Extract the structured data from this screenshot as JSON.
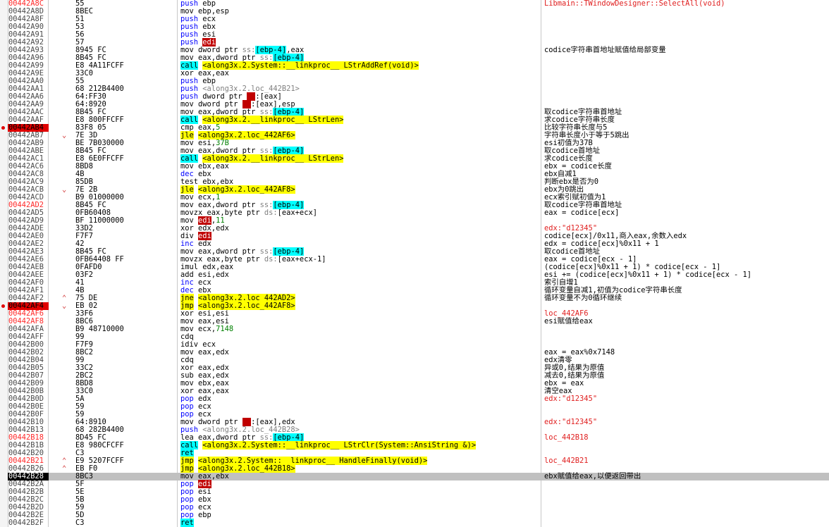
{
  "rows": [
    {
      "addr": "00442A8C",
      "bytes": "55",
      "mn": "push",
      "ops": [
        {
          "t": "ebp"
        }
      ],
      "cmt": "Libmain::TWindowDesigner::SelectAll(void)",
      "cmtRed": true,
      "addrHl": true
    },
    {
      "addr": "00442A8D",
      "bytes": "8BEC",
      "mn": "mov",
      "ops": [
        {
          "t": "ebp,esp"
        }
      ]
    },
    {
      "addr": "00442A8F",
      "bytes": "51",
      "mn": "push",
      "ops": [
        {
          "t": "ecx"
        }
      ]
    },
    {
      "addr": "00442A90",
      "bytes": "53",
      "mn": "push",
      "ops": [
        {
          "t": "ebx"
        }
      ]
    },
    {
      "addr": "00442A91",
      "bytes": "56",
      "mn": "push",
      "ops": [
        {
          "t": "esi"
        }
      ]
    },
    {
      "addr": "00442A92",
      "bytes": "57",
      "mn": "push",
      "ops": [
        {
          "t": "edi",
          "c": "edi"
        }
      ]
    },
    {
      "addr": "00442A93",
      "bytes": "8945 FC",
      "mn": "mov",
      "ops": [
        {
          "t": "dword ptr "
        },
        {
          "t": "ss:",
          "c": "seg"
        },
        {
          "t": "[ebp-4]",
          "c": "mem"
        },
        {
          "t": ",eax"
        }
      ],
      "cmt": "codice字符串首地址赋值给局部变量"
    },
    {
      "addr": "00442A96",
      "bytes": "8B45 FC",
      "mn": "mov",
      "ops": [
        {
          "t": "eax,dword ptr "
        },
        {
          "t": "ss:",
          "c": "seg"
        },
        {
          "t": "[ebp-4]",
          "c": "mem"
        }
      ]
    },
    {
      "addr": "00442A99",
      "bytes": "E8 4A11FCFF",
      "mn": "call",
      "ops": [
        {
          "t": "<along3x.2.System::__linkproc__ LStrAddRef(void)>",
          "c": "callsym"
        }
      ]
    },
    {
      "addr": "00442A9E",
      "bytes": "33C0",
      "mn": "xor",
      "ops": [
        {
          "t": "eax,eax"
        }
      ]
    },
    {
      "addr": "00442AA0",
      "bytes": "55",
      "mn": "push",
      "ops": [
        {
          "t": "ebp"
        }
      ]
    },
    {
      "addr": "00442AA1",
      "bytes": "68 212B4400",
      "bytesU": "212B4400",
      "mn": "push",
      "ops": [
        {
          "t": "<along3x.2.loc_442B21>",
          "c": "sym"
        }
      ]
    },
    {
      "addr": "00442AA6",
      "bytes": "64:FF30",
      "mn": "push",
      "ops": [
        {
          "t": "dword ptr "
        },
        {
          "t": "fs",
          "c": "fs"
        },
        {
          "t": ":[eax]"
        }
      ]
    },
    {
      "addr": "00442AA9",
      "bytes": "64:8920",
      "mn": "mov",
      "ops": [
        {
          "t": "dword ptr "
        },
        {
          "t": "fs",
          "c": "fs"
        },
        {
          "t": ":[eax],esp"
        }
      ]
    },
    {
      "addr": "00442AAC",
      "bytes": "8B45 FC",
      "mn": "mov",
      "ops": [
        {
          "t": "eax,dword ptr "
        },
        {
          "t": "ss:",
          "c": "seg"
        },
        {
          "t": "[ebp-4]",
          "c": "mem"
        }
      ],
      "cmt": "取codice字符串首地址"
    },
    {
      "addr": "00442AAF",
      "bytes": "E8 800FFCFF",
      "mn": "call",
      "ops": [
        {
          "t": "<along3x.2.__linkproc__ LStrLen>",
          "c": "callsym"
        }
      ],
      "cmt": "求codice字符串长度"
    },
    {
      "addr": "00442AB4",
      "bytes": "83F8 05",
      "mn": "cmp",
      "ops": [
        {
          "t": "eax,"
        },
        {
          "t": "5",
          "c": "num"
        }
      ],
      "cmt": "比较字符串长度与5",
      "bp": true
    },
    {
      "addr": "00442AB7",
      "bytes": "7E 3D",
      "mn": "jle",
      "ops": [
        {
          "t": "<along3x.2.loc_442AF6>",
          "c": "jmpsym"
        }
      ],
      "cmt": "字符串长度小于等于5跳出",
      "arrow": "⌄"
    },
    {
      "addr": "00442AB9",
      "bytes": "BE 7B030000",
      "mn": "mov",
      "ops": [
        {
          "t": "esi,"
        },
        {
          "t": "37B",
          "c": "num"
        }
      ],
      "cmt": "esi初值为37B"
    },
    {
      "addr": "00442ABE",
      "bytes": "8B45 FC",
      "mn": "mov",
      "ops": [
        {
          "t": "eax,dword ptr "
        },
        {
          "t": "ss:",
          "c": "seg"
        },
        {
          "t": "[ebp-4]",
          "c": "mem"
        }
      ],
      "cmt": "取codice首地址"
    },
    {
      "addr": "00442AC1",
      "bytes": "E8 6E0FFCFF",
      "mn": "call",
      "ops": [
        {
          "t": "<along3x.2.__linkproc__ LStrLen>",
          "c": "callsym"
        }
      ],
      "cmt": "求codice长度"
    },
    {
      "addr": "00442AC6",
      "bytes": "8BD8",
      "mn": "mov",
      "ops": [
        {
          "t": "ebx,eax"
        }
      ],
      "cmt": "ebx = codice长度"
    },
    {
      "addr": "00442AC8",
      "bytes": "4B",
      "mn": "dec",
      "ops": [
        {
          "t": "ebx"
        }
      ],
      "cmt": "ebx自减1"
    },
    {
      "addr": "00442AC9",
      "bytes": "85DB",
      "mn": "test",
      "ops": [
        {
          "t": "ebx,ebx"
        }
      ],
      "cmt": "判断ebx是否为0"
    },
    {
      "addr": "00442ACB",
      "bytes": "7E 2B",
      "mn": "jle",
      "ops": [
        {
          "t": "<along3x.2.loc_442AF8>",
          "c": "jmpsym"
        }
      ],
      "cmt": "ebx为0跳出",
      "arrow": "⌄"
    },
    {
      "addr": "00442ACD",
      "bytes": "B9 01000000",
      "mn": "mov",
      "ops": [
        {
          "t": "ecx,"
        },
        {
          "t": "1",
          "c": "num"
        }
      ],
      "cmt": "ecx索引赋初值为1"
    },
    {
      "addr": "00442AD2",
      "bytes": "8B45 FC",
      "mn": "mov",
      "ops": [
        {
          "t": "eax,dword ptr "
        },
        {
          "t": "ss:",
          "c": "seg"
        },
        {
          "t": "[ebp-4]",
          "c": "mem"
        }
      ],
      "cmt": "取codice字符串首地址",
      "addrHl": true
    },
    {
      "addr": "00442AD5",
      "bytes": "0FB60408",
      "mn": "movzx",
      "ops": [
        {
          "t": "eax,byte ptr "
        },
        {
          "t": "ds:",
          "c": "seg"
        },
        {
          "t": "[eax+ecx]"
        }
      ],
      "cmt": "eax = codice[ecx]"
    },
    {
      "addr": "00442AD9",
      "bytes": "BF 11000000",
      "mn": "mov",
      "ops": [
        {
          "t": "edi",
          "c": "edi"
        },
        {
          "t": ","
        },
        {
          "t": "11",
          "c": "num"
        }
      ]
    },
    {
      "addr": "00442ADE",
      "bytes": "33D2",
      "mn": "xor",
      "ops": [
        {
          "t": "edx,edx"
        }
      ],
      "cmt": "edx:\"d12345\"",
      "cmtRed": true
    },
    {
      "addr": "00442AE0",
      "bytes": "F7F7",
      "mn": "div",
      "ops": [
        {
          "t": "edi",
          "c": "edi"
        }
      ],
      "cmt": "codice[ecx]/0x11,商入eax,余数入edx"
    },
    {
      "addr": "00442AE2",
      "bytes": "42",
      "mn": "inc",
      "ops": [
        {
          "t": "edx"
        }
      ],
      "cmt": "edx = codice[ecx]%0x11 + 1"
    },
    {
      "addr": "00442AE3",
      "bytes": "8B45 FC",
      "mn": "mov",
      "ops": [
        {
          "t": "eax,dword ptr "
        },
        {
          "t": "ss:",
          "c": "seg"
        },
        {
          "t": "[ebp-4]",
          "c": "mem"
        }
      ],
      "cmt": "取codice首地址"
    },
    {
      "addr": "00442AE6",
      "bytes": "0FB64408 FF",
      "mn": "movzx",
      "ops": [
        {
          "t": "eax,byte ptr "
        },
        {
          "t": "ds:",
          "c": "seg"
        },
        {
          "t": "[eax+ecx-1]"
        }
      ],
      "cmt": "eax = codice[ecx - 1]"
    },
    {
      "addr": "00442AEB",
      "bytes": "0FAFD0",
      "mn": "imul",
      "ops": [
        {
          "t": "edx,eax"
        }
      ],
      "cmt": "(codice[ecx]%0x11 + 1) * codice[ecx - 1]"
    },
    {
      "addr": "00442AEE",
      "bytes": "03F2",
      "mn": "add",
      "ops": [
        {
          "t": "esi,edx"
        }
      ],
      "cmt": "esi += (codice[ecx]%0x11 + 1) * codice[ecx - 1]"
    },
    {
      "addr": "00442AF0",
      "bytes": "41",
      "mn": "inc",
      "ops": [
        {
          "t": "ecx"
        }
      ],
      "cmt": "索引自增1"
    },
    {
      "addr": "00442AF1",
      "bytes": "4B",
      "mn": "dec",
      "ops": [
        {
          "t": "ebx"
        }
      ],
      "cmt": "循环变量自减1,初值为codice字符串长度"
    },
    {
      "addr": "00442AF2",
      "bytes": "75 DE",
      "mn": "jne",
      "ops": [
        {
          "t": "<along3x.2.loc_442AD2>",
          "c": "jmpsym"
        }
      ],
      "cmt": "循环变量不为0循环继续",
      "arrow": "⌃"
    },
    {
      "addr": "00442AF4",
      "bytes": "EB 02",
      "mn": "jmp",
      "ops": [
        {
          "t": "<along3x.2.loc_442AF8>",
          "c": "jmpsym"
        }
      ],
      "bp": true,
      "arrow": "⌄"
    },
    {
      "addr": "00442AF6",
      "bytes": "33F6",
      "mn": "xor",
      "ops": [
        {
          "t": "esi,esi"
        }
      ],
      "cmt": "loc_442AF6",
      "cmtRed": true,
      "addrHl": true
    },
    {
      "addr": "00442AF8",
      "bytes": "8BC6",
      "mn": "mov",
      "ops": [
        {
          "t": "eax,esi"
        }
      ],
      "cmt": "esi赋值给eax",
      "addrHl": true
    },
    {
      "addr": "00442AFA",
      "bytes": "B9 48710000",
      "mn": "mov",
      "ops": [
        {
          "t": "ecx,"
        },
        {
          "t": "7148",
          "c": "num"
        }
      ]
    },
    {
      "addr": "00442AFF",
      "bytes": "99",
      "mn": "cdq",
      "ops": []
    },
    {
      "addr": "00442B00",
      "bytes": "F7F9",
      "mn": "idiv",
      "ops": [
        {
          "t": "ecx"
        }
      ]
    },
    {
      "addr": "00442B02",
      "bytes": "8BC2",
      "mn": "mov",
      "ops": [
        {
          "t": "eax,edx"
        }
      ],
      "cmt": "eax = eax%0x7148"
    },
    {
      "addr": "00442B04",
      "bytes": "99",
      "mn": "cdq",
      "ops": [],
      "cmt": "edx清零"
    },
    {
      "addr": "00442B05",
      "bytes": "33C2",
      "mn": "xor",
      "ops": [
        {
          "t": "eax,edx"
        }
      ],
      "cmt": "异或0,结果为原值"
    },
    {
      "addr": "00442B07",
      "bytes": "2BC2",
      "mn": "sub",
      "ops": [
        {
          "t": "eax,edx"
        }
      ],
      "cmt": "减去0,结果为原值"
    },
    {
      "addr": "00442B09",
      "bytes": "8BD8",
      "mn": "mov",
      "ops": [
        {
          "t": "ebx,eax"
        }
      ],
      "cmt": "ebx = eax"
    },
    {
      "addr": "00442B0B",
      "bytes": "33C0",
      "mn": "xor",
      "ops": [
        {
          "t": "eax,eax"
        }
      ],
      "cmt": "清空eax"
    },
    {
      "addr": "00442B0D",
      "bytes": "5A",
      "mn": "pop",
      "ops": [
        {
          "t": "edx"
        }
      ],
      "cmt": "edx:\"d12345\"",
      "cmtRed": true
    },
    {
      "addr": "00442B0E",
      "bytes": "59",
      "mn": "pop",
      "ops": [
        {
          "t": "ecx"
        }
      ]
    },
    {
      "addr": "00442B0F",
      "bytes": "59",
      "mn": "pop",
      "ops": [
        {
          "t": "ecx"
        }
      ]
    },
    {
      "addr": "00442B10",
      "bytes": "64:8910",
      "mn": "mov",
      "ops": [
        {
          "t": "dword ptr "
        },
        {
          "t": "fs",
          "c": "fs"
        },
        {
          "t": ":[eax],edx"
        }
      ],
      "cmt": "edx:\"d12345\"",
      "cmtRed": true
    },
    {
      "addr": "00442B13",
      "bytes": "68 282B4400",
      "bytesU": "282B4400",
      "mn": "push",
      "ops": [
        {
          "t": "<along3x.2.loc_442B28>",
          "c": "sym"
        }
      ]
    },
    {
      "addr": "00442B18",
      "bytes": "8D45 FC",
      "mn": "lea",
      "ops": [
        {
          "t": "eax,dword ptr "
        },
        {
          "t": "ss:",
          "c": "seg"
        },
        {
          "t": "[ebp-4]",
          "c": "mem"
        }
      ],
      "cmt": "loc_442B18",
      "cmtRed": true,
      "addrHl": true
    },
    {
      "addr": "00442B1B",
      "bytes": "E8 980CFCFF",
      "mn": "call",
      "ops": [
        {
          "t": "<along3x.2.System::__linkproc__ LStrClr(System::AnsiString &)>",
          "c": "callsym"
        }
      ]
    },
    {
      "addr": "00442B20",
      "bytes": "C3",
      "mn": "ret",
      "ops": []
    },
    {
      "addr": "00442B21",
      "bytes": "E9 5207FCFF",
      "mn": "jmp",
      "ops": [
        {
          "t": "<along3x.2.System::__linkproc__ HandleFinally(void)>",
          "c": "jmpsym"
        }
      ],
      "cmt": "loc_442B21",
      "cmtRed": true,
      "addrHl": true,
      "arrow": "⌃"
    },
    {
      "addr": "00442B26",
      "bytes": "EB F0",
      "mn": "jmp",
      "ops": [
        {
          "t": "<along3x.2.loc_442B18>",
          "c": "jmpsym"
        }
      ],
      "arrow": "⌃"
    },
    {
      "addr": "00442B28",
      "bytes": "8BC3",
      "mn": "mov",
      "ops": [
        {
          "t": "eax,ebx"
        }
      ],
      "cmt": "ebx赋值给eax,以便返回带出",
      "sel": true
    },
    {
      "addr": "00442B2A",
      "bytes": "5F",
      "mn": "pop",
      "ops": [
        {
          "t": "edi",
          "c": "edi"
        }
      ]
    },
    {
      "addr": "00442B2B",
      "bytes": "5E",
      "mn": "pop",
      "ops": [
        {
          "t": "esi"
        }
      ]
    },
    {
      "addr": "00442B2C",
      "bytes": "5B",
      "mn": "pop",
      "ops": [
        {
          "t": "ebx"
        }
      ]
    },
    {
      "addr": "00442B2D",
      "bytes": "59",
      "mn": "pop",
      "ops": [
        {
          "t": "ecx"
        }
      ]
    },
    {
      "addr": "00442B2E",
      "bytes": "5D",
      "mn": "pop",
      "ops": [
        {
          "t": "ebp"
        }
      ]
    },
    {
      "addr": "00442B2F",
      "bytes": "C3",
      "mn": "ret",
      "ops": []
    }
  ]
}
